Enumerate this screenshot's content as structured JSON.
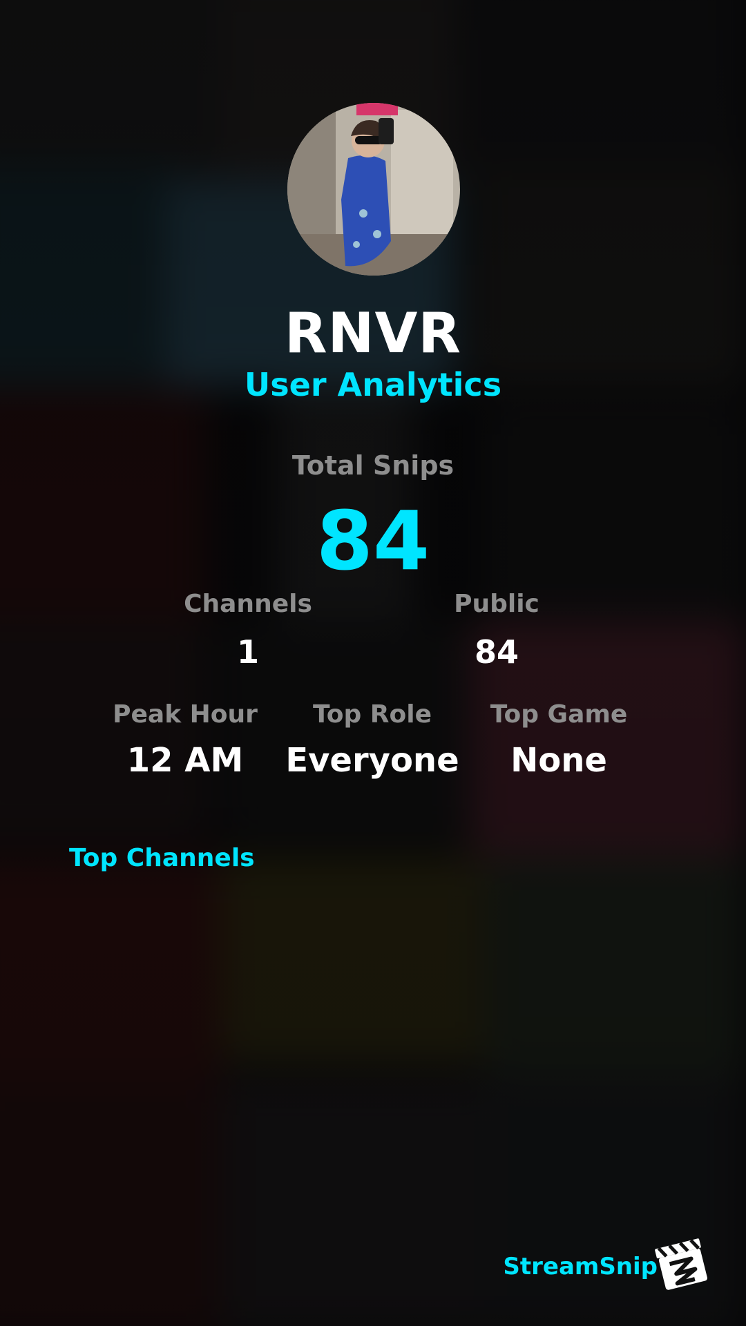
{
  "profile": {
    "username": "RNVR",
    "subtitle": "User Analytics"
  },
  "total_snips": {
    "label": "Total Snips",
    "value": "84"
  },
  "stats_row1": [
    {
      "label": "Channels",
      "value": "1"
    },
    {
      "label": "Public",
      "value": "84"
    }
  ],
  "stats_row2": [
    {
      "label": "Peak Hour",
      "value": "12 AM"
    },
    {
      "label": "Top Role",
      "value": "Everyone"
    },
    {
      "label": "Top Game",
      "value": "None"
    }
  ],
  "sections": {
    "top_channels": "Top Channels"
  },
  "footer": {
    "brand": "StreamSnip",
    "logo_icon": "clapperboard-logo-icon"
  },
  "colors": {
    "accent": "#00e5ff",
    "label": "#8e8e8e",
    "text": "#ffffff",
    "background": "#0a0a0c"
  }
}
